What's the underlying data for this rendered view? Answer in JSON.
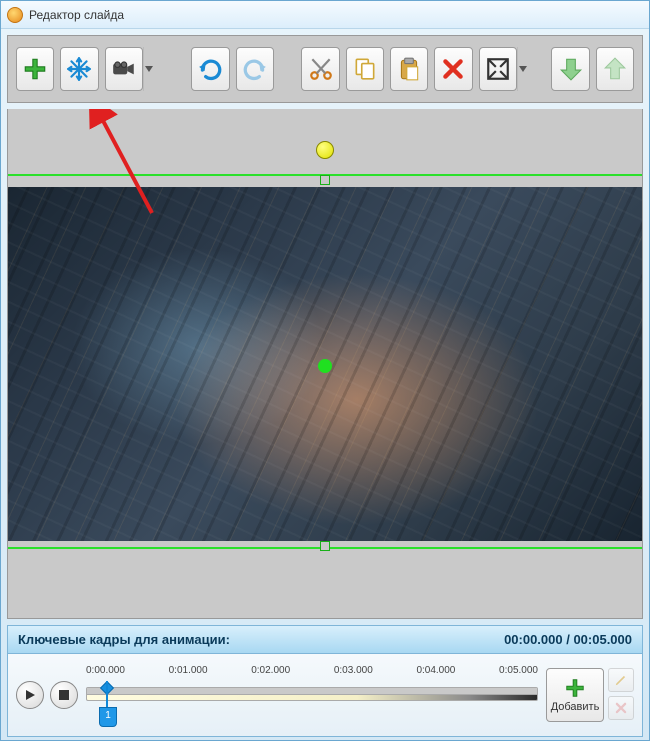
{
  "window": {
    "title": "Редактор слайда"
  },
  "toolbar": {
    "icons": {
      "add": "plus-icon",
      "effects": "snowflake-icon",
      "camera": "camera-icon",
      "undo": "undo-icon",
      "redo": "redo-icon",
      "cut": "scissors-icon",
      "copy": "copy-icon",
      "paste": "paste-icon",
      "delete": "delete-icon",
      "fullscreen": "fullscreen-icon",
      "down": "arrow-down-icon",
      "up": "arrow-up-icon"
    }
  },
  "timeline": {
    "header_label": "Ключевые кадры для анимации:",
    "time_current": "00:00.000",
    "time_total": "00:05.000",
    "time_display": "00:00.000 / 00:05.000",
    "ticks": [
      "0:00.000",
      "0:01.000",
      "0:02.000",
      "0:03.000",
      "0:04.000",
      "0:05.000"
    ],
    "add_button": "Добавить",
    "playhead_index": "1"
  },
  "colors": {
    "accent_blue": "#1890e0",
    "green": "#20e020",
    "arrow_red": "#e02020"
  }
}
